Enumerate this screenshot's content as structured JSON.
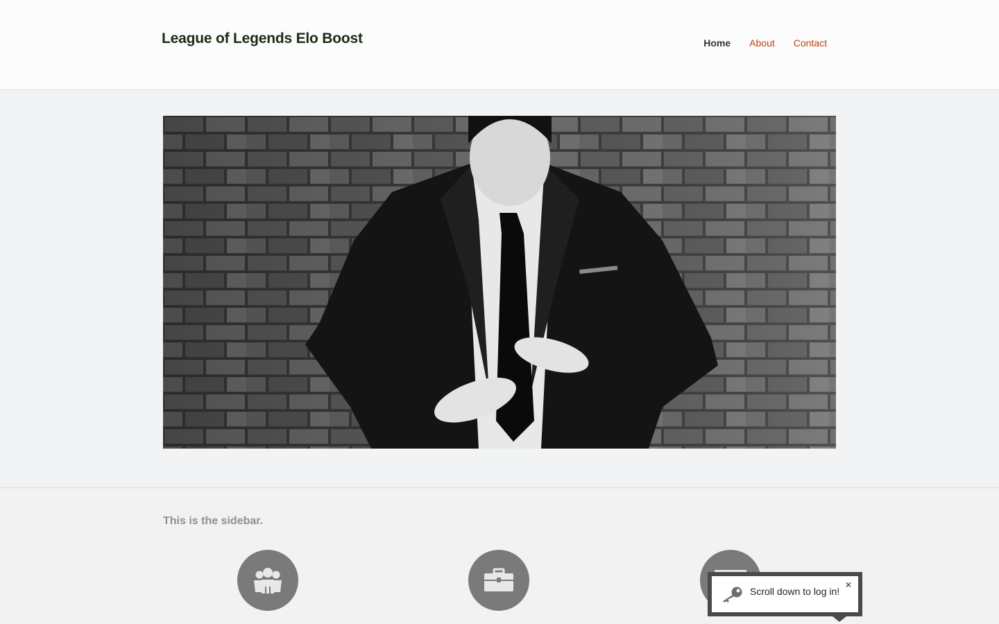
{
  "header": {
    "site_title": "League of Legends Elo Boost",
    "nav": [
      {
        "label": "Home",
        "active": true
      },
      {
        "label": "About",
        "active": false
      },
      {
        "label": "Contact",
        "active": false
      }
    ]
  },
  "hero": {
    "image_icon": "man-in-suit-brick-wall-photo"
  },
  "sidebar": {
    "text": "This is the sidebar.",
    "icons": [
      "group-icon",
      "briefcase-icon",
      "inbox-icon"
    ]
  },
  "tooltip": {
    "text": "Scroll down to log in!",
    "close": "×",
    "icon": "key-icon"
  },
  "colors": {
    "accent": "#b5420f",
    "title": "#1c2a14",
    "icon_circle": "#7a7a7a"
  }
}
